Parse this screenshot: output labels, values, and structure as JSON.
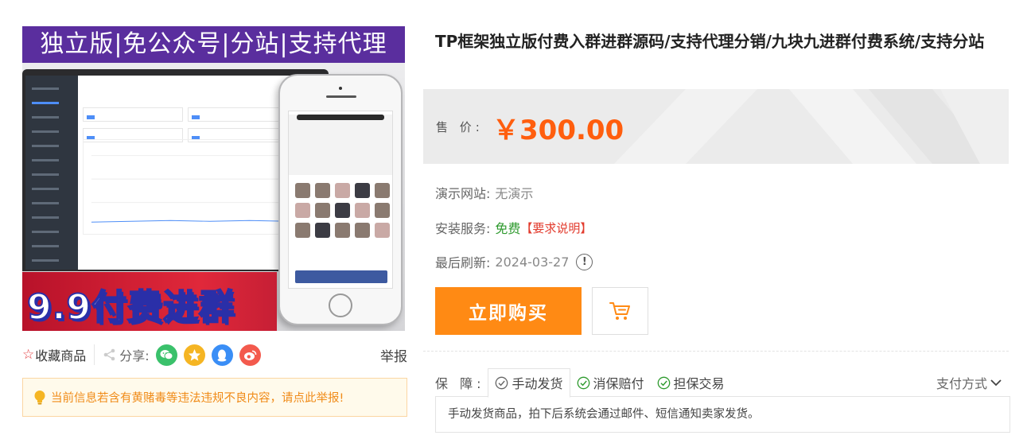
{
  "image": {
    "banner_top": "独立版|免公众号|分站|支持代理",
    "banner_bottom": "9.9付费进群"
  },
  "actions": {
    "favorite_star": "☆",
    "favorite_label": "收藏商品",
    "share_label": "分享:",
    "share_icons": [
      "wechat-icon",
      "qzone-icon",
      "qq-icon",
      "weibo-icon"
    ],
    "report_label": "举报"
  },
  "warning": {
    "text": "当前信息若含有黄赌毒等违法违规不良内容，请点此举报!"
  },
  "product": {
    "title": "TP框架独立版付费入群进群源码/支持代理分销/九块九进群付费系统/支持分站",
    "price_label": "售 价:",
    "price": "￥300.00"
  },
  "info": {
    "demo_label": "演示网站:",
    "demo_value": "无演示",
    "install_label": "安装服务:",
    "install_value": "免费",
    "install_link": "【要求说明】",
    "refresh_label": "最后刷新:",
    "refresh_value": "2024-03-27",
    "refresh_icon": "!"
  },
  "buttons": {
    "buy": "立即购买"
  },
  "guarantee": {
    "label": "保 障:",
    "tabs": [
      "手动发货",
      "消保赔付",
      "担保交易"
    ],
    "pay_method": "支付方式",
    "description": "手动发货商品，拍下后系统会通过邮件、短信通知卖家发货。"
  },
  "colors": {
    "price": "#ff5e0e",
    "buy_button": "#ff8a14",
    "free": "#2e9a2e",
    "link_red": "#e23a2c",
    "warning_text": "#f08b18"
  }
}
